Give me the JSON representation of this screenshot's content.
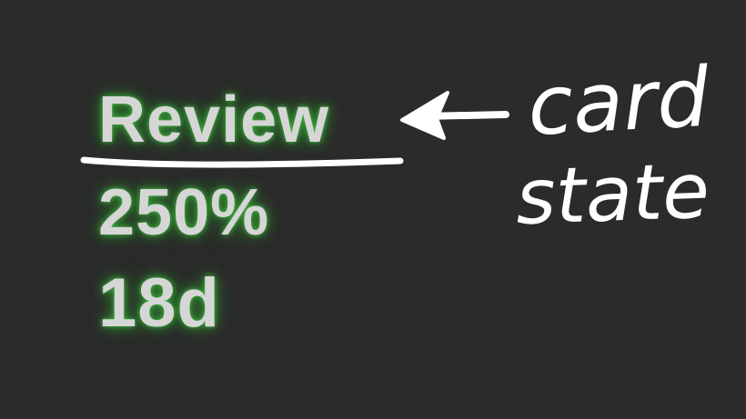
{
  "card_info": {
    "state": "Review",
    "ease": "250%",
    "interval": "18d"
  },
  "annotation": {
    "line1": "card",
    "line2": "state",
    "pointer": "arrow-left-icon"
  },
  "colors": {
    "background": "#2b2b2b",
    "text": "#d6d6d6",
    "glow": "#3cb43c",
    "ink": "#ffffff"
  }
}
